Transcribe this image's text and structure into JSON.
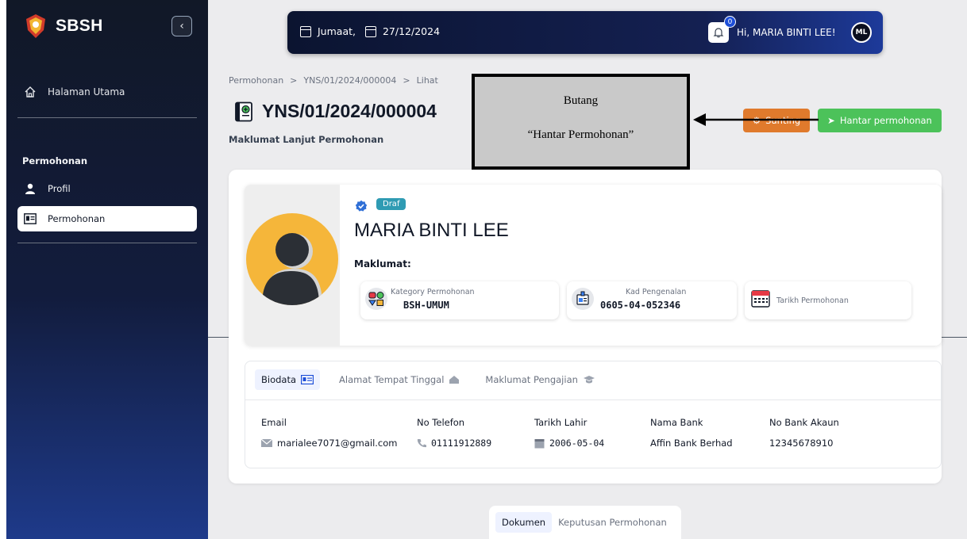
{
  "app": {
    "name": "SBSH"
  },
  "sidebar": {
    "home_label": "Halaman Utama",
    "section_title": "Permohonan",
    "items": [
      {
        "label": "Profil",
        "icon": "user-icon",
        "active": false
      },
      {
        "label": "Permohonan",
        "icon": "id-card-icon",
        "active": true
      }
    ]
  },
  "topbar": {
    "day": "Jumaat,",
    "date": "27/12/2024",
    "notification_count": "0",
    "greeting": "Hi, MARIA BINTI LEE!",
    "avatar_initials": "ML"
  },
  "breadcrumb": [
    "Permohonan",
    ">",
    "YNS/01/2024/000004",
    ">",
    "Lihat"
  ],
  "page": {
    "title": "YNS/01/2024/000004",
    "subtitle": "Maklumat Lanjut Permohonan"
  },
  "actions": {
    "edit_label": "Sunting",
    "submit_label": "Hantar permohonan"
  },
  "profile": {
    "status": "Draf",
    "name": "MARIA BINTI LEE",
    "info_label": "Maklumat:",
    "cards": [
      {
        "label": "Kategory Permohonan",
        "value": "BSH-UMUM"
      },
      {
        "label": "Kad Pengenalan",
        "value": "0605-04-052346"
      },
      {
        "label": "Tarikh Permohonan",
        "value": ""
      }
    ]
  },
  "tabs": [
    {
      "label": "Biodata",
      "active": true
    },
    {
      "label": "Alamat Tempat Tinggal",
      "active": false
    },
    {
      "label": "Maklumat Pengajian",
      "active": false
    }
  ],
  "biodata": {
    "columns": [
      {
        "header": "Email",
        "value": "marialee7071@gmail.com",
        "icon": "mail-icon"
      },
      {
        "header": "No Telefon",
        "value": "01111912889",
        "icon": "phone-icon"
      },
      {
        "header": "Tarikh Lahir",
        "value": "2006-05-04",
        "icon": "calendar-icon"
      },
      {
        "header": "Nama Bank",
        "value": "Affin Bank Berhad",
        "icon": ""
      },
      {
        "header": "No Bank Akaun",
        "value": "12345678910",
        "icon": ""
      }
    ]
  },
  "bottom_tabs": [
    {
      "label": "Dokumen",
      "active": true
    },
    {
      "label": "Keputusan Permohonan",
      "active": false
    }
  ],
  "annotation": {
    "line1": "Butang",
    "line2": "“Hantar Permohonan”"
  },
  "colors": {
    "edit_button": "#e07a2c",
    "submit_button": "#4cc25a",
    "status_badge": "#2f9bb3",
    "avatar_bg": "#f5b63a"
  }
}
